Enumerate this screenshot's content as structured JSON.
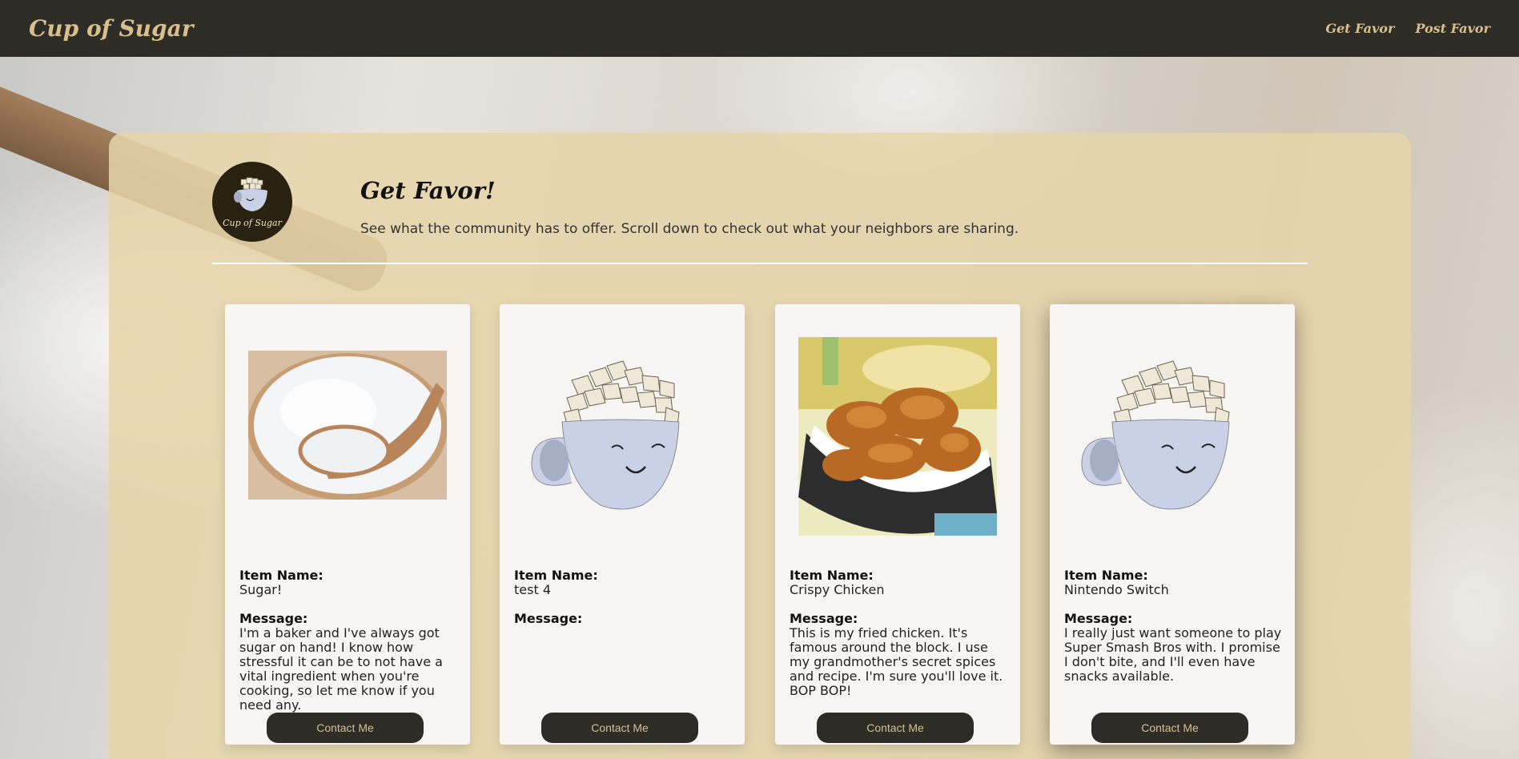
{
  "navbar": {
    "brand": "Cup of Sugar",
    "links": [
      "Get Favor",
      "Post Favor"
    ]
  },
  "header": {
    "logo_text": "Cup of Sugar",
    "title": "Get Favor!",
    "subtitle": "See what the community has to offer. Scroll down to check out what your neighbors are sharing."
  },
  "cards": [
    {
      "image": "sugar-bowl-photo",
      "item_label": "Item Name:",
      "item_name": "Sugar!",
      "message_label": "Message:",
      "message": "I'm a baker and I've always got sugar on hand! I know how stressful it can be to not have a vital ingredient when you're cooking, so let me know if you need any.",
      "button": "Contact Me"
    },
    {
      "image": "sugar-cup-illustration",
      "item_label": "Item Name:",
      "item_name": "test 4",
      "message_label": "Message:",
      "message": "",
      "button": "Contact Me"
    },
    {
      "image": "fried-chicken-photo",
      "item_label": "Item Name:",
      "item_name": "Crispy Chicken",
      "message_label": "Message:",
      "message": "This is my fried chicken. It's famous around the block. I use my grandmother's secret spices and recipe. I'm sure you'll love it. BOP BOP!",
      "button": "Contact Me"
    },
    {
      "image": "sugar-cup-illustration",
      "item_label": "Item Name:",
      "item_name": "Nintendo Switch",
      "message_label": "Message:",
      "message": "I really just want someone to play Super Smash Bros with. I promise I don't bite, and I'll even have snacks available.",
      "button": "Contact Me"
    }
  ],
  "colors": {
    "navbar_bg": "#2e2c26",
    "accent": "#d9bf8c",
    "panel_bg": "#e6d5aa",
    "card_bg": "#f7f6f4"
  }
}
